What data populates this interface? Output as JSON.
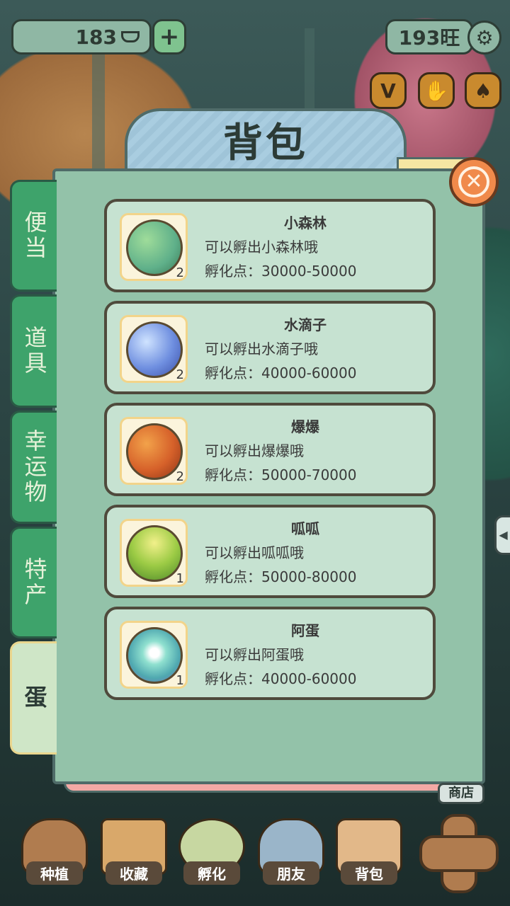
{
  "top_bar": {
    "coins": "183",
    "plus_symbol": "+",
    "wang_points": "193旺",
    "settings_icon": "gear-icon"
  },
  "tools": [
    "V",
    "✋",
    "♠"
  ],
  "panel": {
    "title": "背包"
  },
  "tabs": [
    {
      "label": "便当",
      "active": false
    },
    {
      "label": "道具",
      "active": false
    },
    {
      "label": "幸运物",
      "active": false
    },
    {
      "label": "特产",
      "active": false
    },
    {
      "label": "蛋",
      "active": true
    }
  ],
  "items": [
    {
      "name": "小森林",
      "desc": "可以孵出小森林哦",
      "points": "孵化点：30000-50000",
      "count": "2",
      "color": "#5fb08a"
    },
    {
      "name": "水滴子",
      "desc": "可以孵出水滴子哦",
      "points": "孵化点：40000-60000",
      "count": "2",
      "color": "#4c6ec9"
    },
    {
      "name": "爆爆",
      "desc": "可以孵出爆爆哦",
      "points": "孵化点：50000-70000",
      "count": "2",
      "color": "#d6612a"
    },
    {
      "name": "呱呱",
      "desc": "可以孵出呱呱哦",
      "points": "孵化点：50000-80000",
      "count": "1",
      "color": "#8fc23a"
    },
    {
      "name": "阿蛋",
      "desc": "可以孵出阿蛋哦",
      "points": "孵化点：40000-60000",
      "count": "1",
      "color": "#5fc2b0"
    }
  ],
  "bottom_nav": [
    {
      "label": "种植",
      "color": "#b07c4f"
    },
    {
      "label": "收藏",
      "color": "#d9a86a"
    },
    {
      "label": "孵化",
      "color": "#c7d7a1"
    },
    {
      "label": "朋友",
      "color": "#9ab5c9"
    },
    {
      "label": "背包",
      "color": "#e2b889"
    }
  ],
  "shop_label": "商店"
}
